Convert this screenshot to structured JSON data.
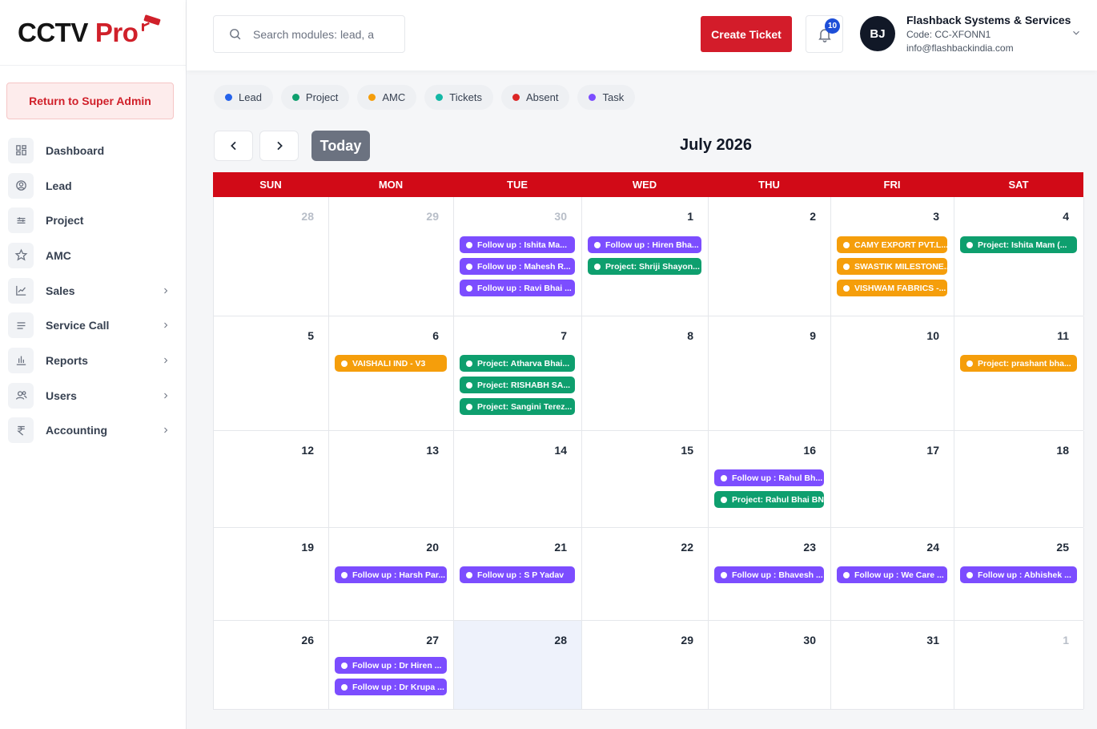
{
  "brand": {
    "part1": "CCTV",
    "part2": "Pro"
  },
  "sidebar": {
    "return_label": "Return to Super Admin",
    "items": [
      {
        "label": "Dashboard",
        "icon": "dashboard-icon",
        "chevron": false
      },
      {
        "label": "Lead",
        "icon": "lead-icon",
        "chevron": false
      },
      {
        "label": "Project",
        "icon": "project-icon",
        "chevron": false
      },
      {
        "label": "AMC",
        "icon": "star-icon",
        "chevron": false
      },
      {
        "label": "Sales",
        "icon": "chart-line-icon",
        "chevron": true
      },
      {
        "label": "Service Call",
        "icon": "list-icon",
        "chevron": true
      },
      {
        "label": "Reports",
        "icon": "bar-chart-icon",
        "chevron": true
      },
      {
        "label": "Users",
        "icon": "users-icon",
        "chevron": true
      },
      {
        "label": "Accounting",
        "icon": "rupee-icon",
        "chevron": true
      }
    ]
  },
  "topbar": {
    "search_placeholder": "Search modules: lead, a",
    "create_label": "Create Ticket",
    "notif_count": "10",
    "avatar": "BJ",
    "org_name": "Flashback Systems & Services",
    "org_code": "Code: CC-XFONN1",
    "org_email": "info@flashbackindia.com"
  },
  "legend": [
    {
      "label": "Lead",
      "color": "#2563eb"
    },
    {
      "label": "Project",
      "color": "#0e9f6e"
    },
    {
      "label": "AMC",
      "color": "#f59e0b"
    },
    {
      "label": "Tickets",
      "color": "#14b8a6"
    },
    {
      "label": "Absent",
      "color": "#dc2626"
    },
    {
      "label": "Task",
      "color": "#7c4dff"
    }
  ],
  "calendar": {
    "today_label": "Today",
    "month": "July 2026",
    "weekdays": [
      "SUN",
      "MON",
      "TUE",
      "WED",
      "THU",
      "FRI",
      "SAT"
    ],
    "colors": {
      "purple": "#7c4dff",
      "green": "#0e9f6e",
      "orange": "#f59e0b"
    },
    "weeks": [
      [
        {
          "day": "28",
          "muted": true,
          "events": []
        },
        {
          "day": "29",
          "muted": true,
          "events": []
        },
        {
          "day": "30",
          "muted": true,
          "events": [
            {
              "text": "Follow up : Ishita Ma...",
              "color": "purple"
            },
            {
              "text": "Follow up : Mahesh R...",
              "color": "purple"
            },
            {
              "text": "Follow up : Ravi Bhai ...",
              "color": "purple"
            }
          ]
        },
        {
          "day": "1",
          "events": [
            {
              "text": "Follow up : Hiren Bha...",
              "color": "purple"
            },
            {
              "text": "Project: Shriji Shayon...",
              "color": "green"
            }
          ]
        },
        {
          "day": "2",
          "events": []
        },
        {
          "day": "3",
          "events": [
            {
              "text": "CAMY EXPORT PVT.L...",
              "color": "orange"
            },
            {
              "text": "SWASTIK MILESTONE...",
              "color": "orange"
            },
            {
              "text": "VISHWAM FABRICS -...",
              "color": "orange"
            }
          ]
        },
        {
          "day": "4",
          "events": [
            {
              "text": "Project: Ishita Mam (...",
              "color": "green"
            }
          ]
        }
      ],
      [
        {
          "day": "5",
          "events": []
        },
        {
          "day": "6",
          "events": [
            {
              "text": "VAISHALI IND - V3",
              "color": "orange"
            }
          ]
        },
        {
          "day": "7",
          "events": [
            {
              "text": "Project: Atharva Bhai...",
              "color": "green"
            },
            {
              "text": "Project: RISHABH SA...",
              "color": "green"
            },
            {
              "text": "Project: Sangini Terez...",
              "color": "green"
            }
          ]
        },
        {
          "day": "8",
          "events": []
        },
        {
          "day": "9",
          "events": []
        },
        {
          "day": "10",
          "events": []
        },
        {
          "day": "11",
          "events": [
            {
              "text": "Project: prashant bha...",
              "color": "orange"
            }
          ]
        }
      ],
      [
        {
          "day": "12",
          "events": []
        },
        {
          "day": "13",
          "events": []
        },
        {
          "day": "14",
          "events": []
        },
        {
          "day": "15",
          "events": []
        },
        {
          "day": "16",
          "events": [
            {
              "text": "Follow up : Rahul Bh...",
              "color": "purple"
            },
            {
              "text": "Project: Rahul Bhai BNI",
              "color": "green"
            }
          ]
        },
        {
          "day": "17",
          "events": []
        },
        {
          "day": "18",
          "events": []
        }
      ],
      [
        {
          "day": "19",
          "events": []
        },
        {
          "day": "20",
          "events": [
            {
              "text": "Follow up : Harsh Par...",
              "color": "purple"
            }
          ]
        },
        {
          "day": "21",
          "events": [
            {
              "text": "Follow up : S P Yadav",
              "color": "purple"
            }
          ]
        },
        {
          "day": "22",
          "events": []
        },
        {
          "day": "23",
          "events": [
            {
              "text": "Follow up : Bhavesh ...",
              "color": "purple"
            }
          ]
        },
        {
          "day": "24",
          "events": [
            {
              "text": "Follow up : We Care ...",
              "color": "purple"
            }
          ]
        },
        {
          "day": "25",
          "events": [
            {
              "text": "Follow up : Abhishek ...",
              "color": "purple"
            }
          ]
        }
      ],
      [
        {
          "day": "26",
          "events": []
        },
        {
          "day": "27",
          "events": [
            {
              "text": "Follow up : Dr Hiren ...",
              "color": "purple"
            },
            {
              "text": "Follow up : Dr Krupa ...",
              "color": "purple"
            }
          ]
        },
        {
          "day": "28",
          "today": true,
          "events": []
        },
        {
          "day": "29",
          "events": []
        },
        {
          "day": "30",
          "events": []
        },
        {
          "day": "31",
          "events": []
        },
        {
          "day": "1",
          "muted": true,
          "events": []
        }
      ]
    ]
  }
}
